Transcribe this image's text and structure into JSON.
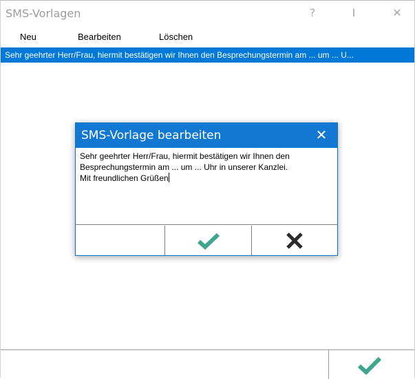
{
  "window": {
    "title": "SMS-Vorlagen",
    "help_label": "?",
    "pin_label": "I",
    "close_label": "✕"
  },
  "menu": {
    "items": [
      {
        "label": "Neu"
      },
      {
        "label": "Bearbeiten"
      },
      {
        "label": "Löschen"
      }
    ]
  },
  "list": {
    "rows": [
      {
        "text": "Sehr geehrter Herr/Frau, hiermit bestätigen wir Ihnen den Besprechungstermin am ... um ... U..."
      }
    ]
  },
  "dialog": {
    "title": "SMS-Vorlage bearbeiten",
    "close_label": "✕",
    "text_lines": [
      "Sehr geehrter Herr/Frau, hiermit bestätigen wir Ihnen den",
      "Besprechungstermin am ... um ... Uhr in unserer Kanzlei.",
      "Mit freundlichen Grüßen"
    ],
    "confirm_icon": "checkmark-icon",
    "cancel_icon": "x-icon"
  },
  "colors": {
    "accent": "#0078d7",
    "check_green": "#3fa58d"
  }
}
